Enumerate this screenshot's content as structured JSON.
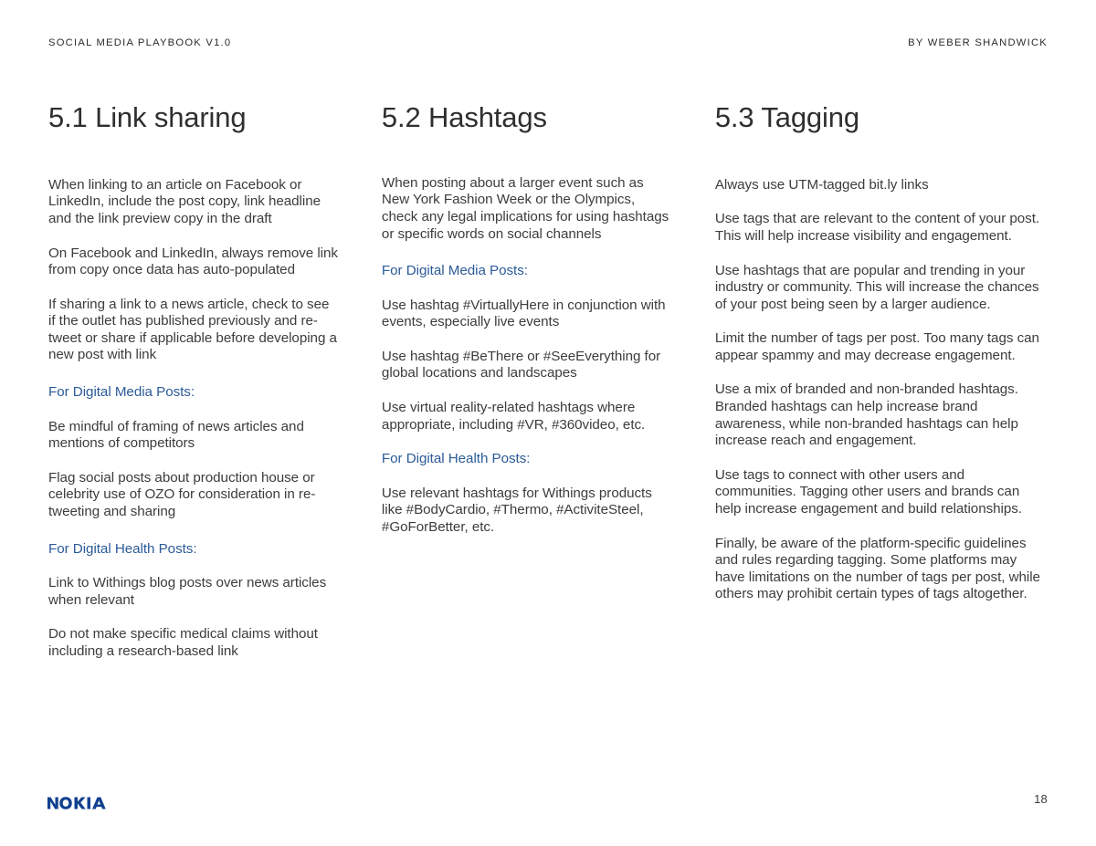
{
  "document": {
    "running_head_left": "SOCIAL MEDIA PLAYBOOK V1.0",
    "running_head_right": "BY WEBER SHANDWICK",
    "page_number": "18",
    "logo_text": "NOKIA",
    "logo_color": "#124191",
    "accent_color": "#2c5b98",
    "body_color": "#3c3c3c",
    "background_color": "#ffffff"
  },
  "columns": [
    {
      "heading": "5.1 Link sharing",
      "blocks": [
        {
          "type": "paragraph",
          "text": "When linking to an article on Facebook or LinkedIn, include the post copy, link headline and the link preview copy in the draft"
        },
        {
          "type": "paragraph",
          "text": "On Facebook and LinkedIn, always remove link from copy once data has auto-populated"
        },
        {
          "type": "paragraph",
          "text": "If sharing a link to a news article, check to see if the outlet has published previously and re-tweet or share if applicable before developing a new post with link"
        },
        {
          "type": "subhead",
          "text": "For Digital Media Posts:"
        },
        {
          "type": "paragraph",
          "text": "Be mindful of framing of news articles and mentions of competitors"
        },
        {
          "type": "paragraph",
          "text": "Flag social posts about production house or celebrity use of OZO for consideration in re-tweeting and sharing"
        },
        {
          "type": "subhead",
          "text": "For Digital Health Posts:"
        },
        {
          "type": "paragraph",
          "text": "Link to Withings blog posts over news articles when relevant"
        },
        {
          "type": "paragraph",
          "text": "Do not make specific medical claims without including a research-based link"
        }
      ]
    },
    {
      "heading": "5.2 Hashtags",
      "blocks": [
        {
          "type": "paragraph",
          "text": "When posting about a larger event such as New York Fashion Week or the Olympics, check any legal implications for using hashtags or specific words on social channels"
        },
        {
          "type": "subhead",
          "text": "For Digital Media Posts:"
        },
        {
          "type": "paragraph",
          "text": "Use hashtag #VirtuallyHere in conjunction with events, especially live events"
        },
        {
          "type": "paragraph",
          "text": "Use hashtag #BeThere or #SeeEverything for global locations and landscapes"
        },
        {
          "type": "paragraph",
          "text": "Use virtual reality-related hashtags where appropriate, including #VR, #360video, etc."
        },
        {
          "type": "subhead",
          "text": "For Digital Health Posts:"
        },
        {
          "type": "paragraph",
          "text": "Use relevant hashtags for Withings products like #BodyCardio, #Thermo, #ActiviteSteel, #GoForBetter, etc."
        }
      ]
    },
    {
      "heading": "5.3 Tagging",
      "blocks": [
        {
          "type": "paragraph",
          "text": "Always use UTM-tagged bit.ly links"
        },
        {
          "type": "paragraph",
          "text": "Use tags that are relevant to the content of your post. This will help increase visibility and engagement."
        },
        {
          "type": "paragraph",
          "text": "Use hashtags that are popular and trending in your industry or community. This will increase the chances of your post being seen by a larger audience."
        },
        {
          "type": "paragraph",
          "text": "Limit the number of tags per post. Too many tags can appear spammy and may decrease engagement."
        },
        {
          "type": "paragraph",
          "text": "Use a mix of branded and non-branded hashtags. Branded hashtags can help increase brand awareness, while non-branded hashtags can help increase reach and engagement."
        },
        {
          "type": "paragraph",
          "text": "Use tags to connect with other users and communities. Tagging other users and brands can help increase engagement and build relationships."
        },
        {
          "type": "paragraph",
          "text": "Finally, be aware of the platform-specific guidelines and rules regarding tagging. Some platforms may have limitations on the number of tags per post, while others may prohibit certain types of tags altogether."
        }
      ]
    }
  ]
}
